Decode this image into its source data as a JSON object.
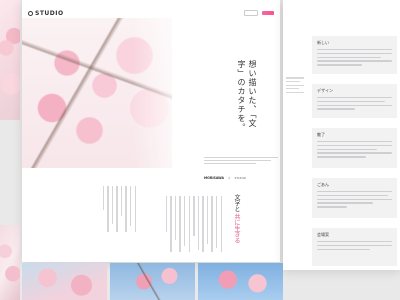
{
  "header": {
    "logo": "STUDIO",
    "nav": [
      "",
      "",
      "",
      "",
      ""
    ],
    "login_label": "",
    "signup_label": ""
  },
  "hero": {
    "headline": "想い描いた、「文字」のカタチを。",
    "brand_left": "MORISAWA",
    "brand_sep": "×",
    "brand_right": "STUDIO"
  },
  "section": {
    "title_line1": "文字と",
    "title_line2": "共に生きる"
  },
  "doc_cards": [
    {
      "title": "新しい"
    },
    {
      "title": "デザイン"
    },
    {
      "title": "魅了"
    },
    {
      "title": "ごあん"
    },
    {
      "title": "会場案"
    }
  ],
  "colors": {
    "accent": "#e35d8e",
    "button_gradient_start": "#f06aa8",
    "button_gradient_end": "#ff4e8a",
    "card_bg": "#f2f2f3"
  }
}
